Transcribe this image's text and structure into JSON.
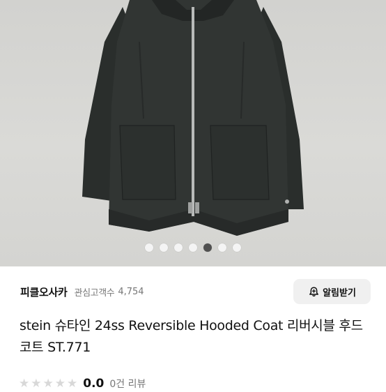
{
  "product_images": {
    "image_alt": "coat-photo",
    "total": 7,
    "active_index": 4
  },
  "seller": {
    "name": "피클오사카",
    "follower_label": "관심고객수",
    "follower_count": "4,754",
    "alert_button_label": "알림받기",
    "alert_icon": "bell-plus-icon"
  },
  "product": {
    "title": "stein 슈타인 24ss Reversible Hooded Coat 리버시블 후드 코트 ST.771"
  },
  "rating": {
    "score": "0.0",
    "review_count_label": "0건 리뷰",
    "stars_filled": 0,
    "stars_total": 5
  },
  "colors": {
    "coat": "#2f3331",
    "background_photo": "#d6d6d3",
    "active_dot": "#505050",
    "button_bg": "#f0f0f0"
  }
}
